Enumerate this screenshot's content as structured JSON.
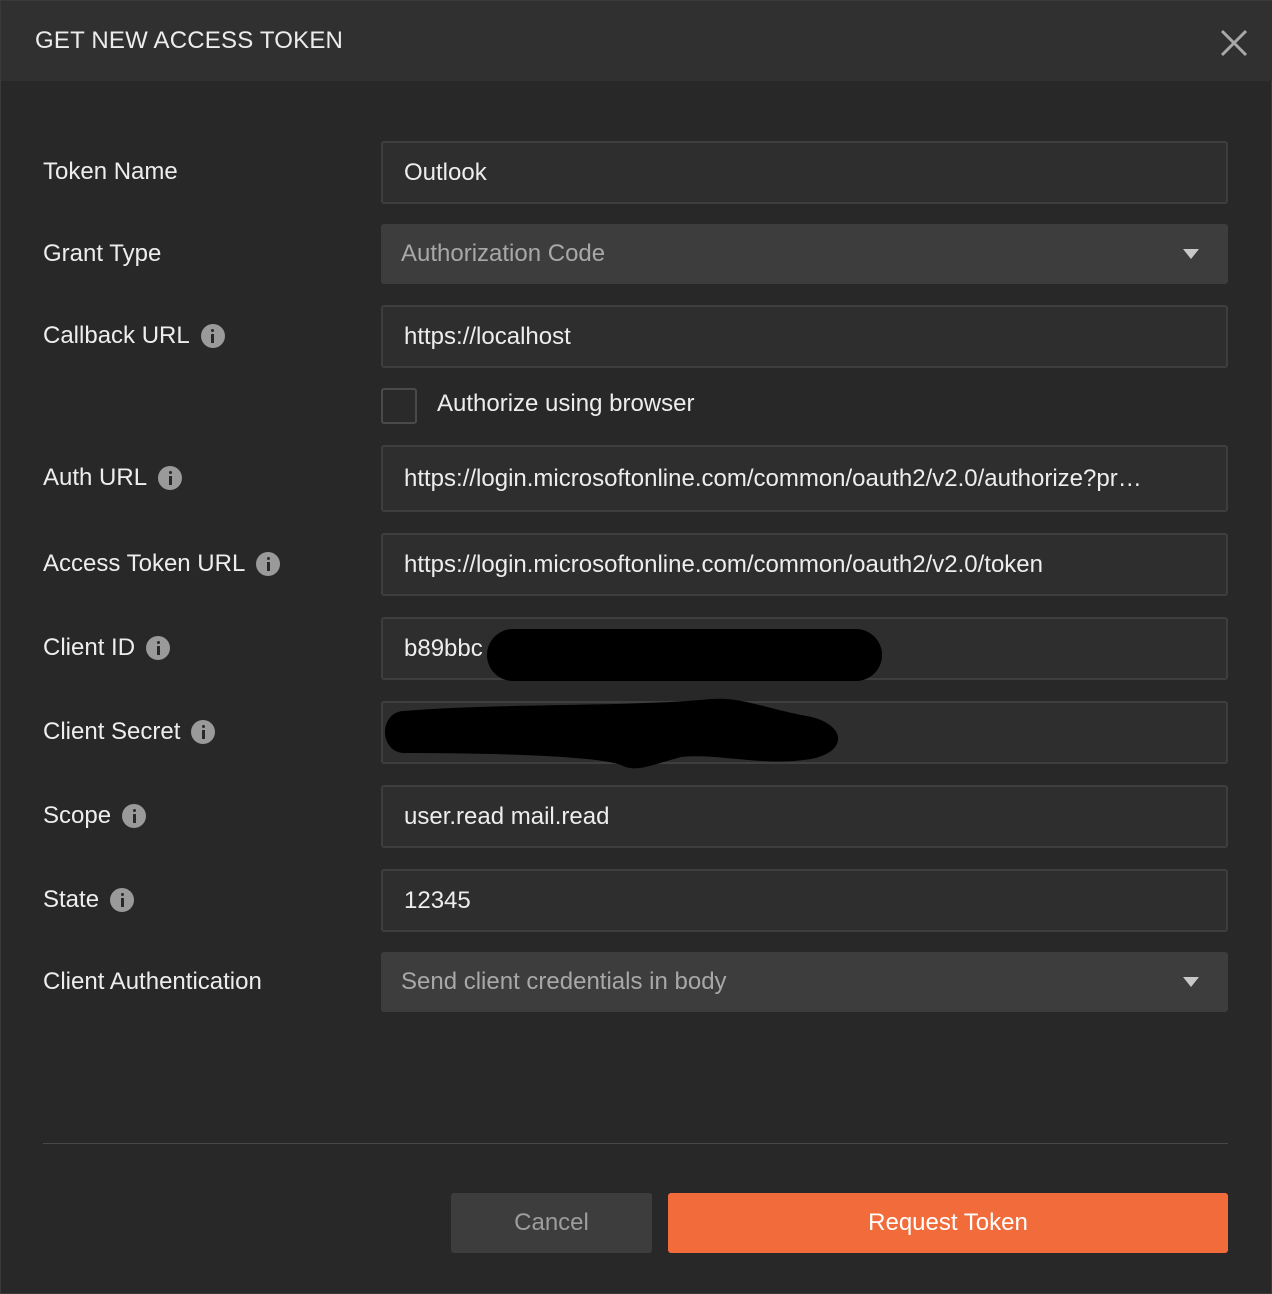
{
  "dialog": {
    "title": "GET NEW ACCESS TOKEN"
  },
  "form": {
    "token_name": {
      "label": "Token Name",
      "value": "Outlook"
    },
    "grant_type": {
      "label": "Grant Type",
      "value": "Authorization Code"
    },
    "callback_url": {
      "label": "Callback URL",
      "value": "https://localhost"
    },
    "authorize_browser": {
      "label": "Authorize using browser",
      "checked": false
    },
    "auth_url": {
      "label": "Auth URL",
      "value": "https://login.microsoftonline.com/common/oauth2/v2.0/authorize?pr…"
    },
    "access_token_url": {
      "label": "Access Token URL",
      "value": "https://login.microsoftonline.com/common/oauth2/v2.0/token"
    },
    "client_id": {
      "label": "Client ID",
      "value": "b89bbc"
    },
    "client_secret": {
      "label": "Client Secret",
      "value": ""
    },
    "scope": {
      "label": "Scope",
      "value": "user.read mail.read"
    },
    "state": {
      "label": "State",
      "value": "12345"
    },
    "client_authentication": {
      "label": "Client Authentication",
      "value": "Send client credentials in body"
    }
  },
  "actions": {
    "cancel_label": "Cancel",
    "request_label": "Request Token"
  },
  "colors": {
    "accent": "#f26b3a",
    "background": "#282828",
    "header": "#303030"
  },
  "icons": {
    "close": "close-icon",
    "info": "info-icon",
    "dropdown": "chevron-down-icon"
  }
}
